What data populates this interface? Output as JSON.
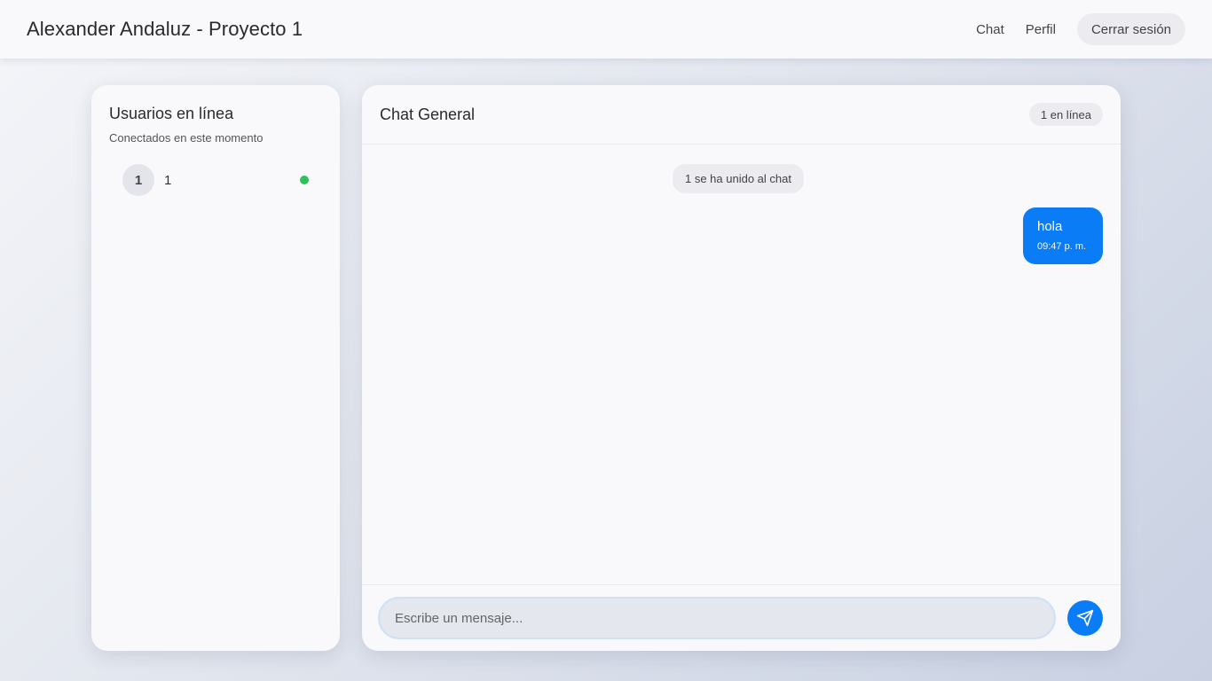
{
  "header": {
    "title": "Alexander Andaluz - Proyecto 1",
    "nav": {
      "chat": "Chat",
      "profile": "Perfil",
      "logout": "Cerrar sesión"
    }
  },
  "sidebar": {
    "title": "Usuarios en línea",
    "subtitle": "Conectados en este momento",
    "users": [
      {
        "avatar": "1",
        "name": "1",
        "status": "online"
      }
    ]
  },
  "chat": {
    "title": "Chat General",
    "online_badge": "1 en línea",
    "system_message": "1 se ha unido al chat",
    "messages": [
      {
        "text": "hola",
        "time": "09:47 p. m.",
        "own": true
      }
    ],
    "input_placeholder": "Escribe un mensaje...",
    "send_icon": "send-icon"
  },
  "colors": {
    "accent": "#0a7cf6",
    "online": "#2ec05a"
  }
}
